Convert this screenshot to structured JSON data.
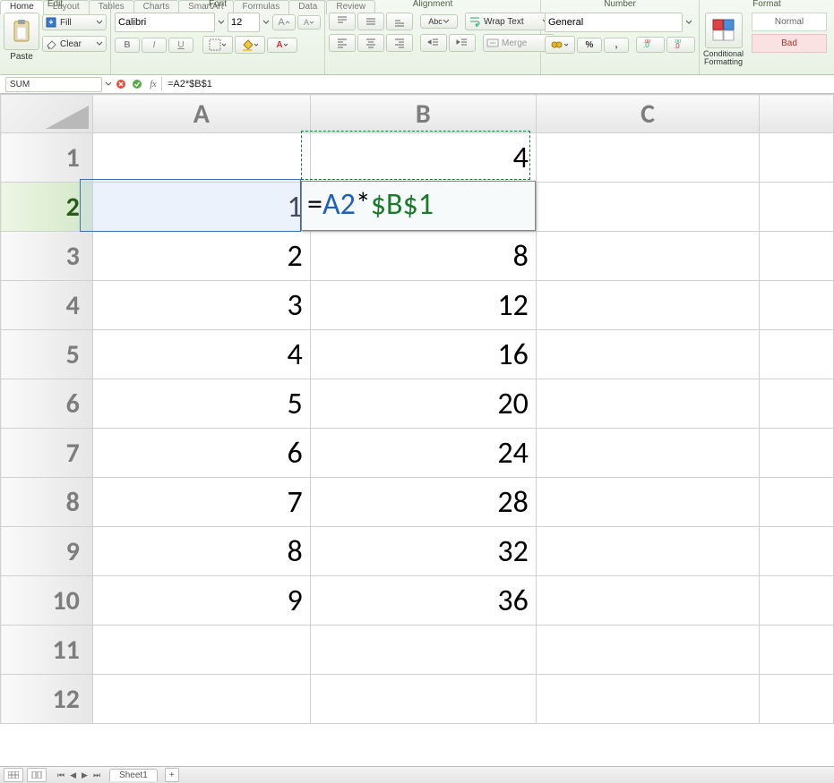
{
  "tabs": [
    "Home",
    "Layout",
    "Tables",
    "Charts",
    "SmartArt",
    "Formulas",
    "Data",
    "Review"
  ],
  "groups": {
    "edit_label": "Edit",
    "font_label": "Font",
    "align_label": "Alignment",
    "number_label": "Number",
    "format_label": "Format",
    "paste": "Paste",
    "fill": "Fill",
    "clear": "Clear",
    "font_name": "Calibri",
    "font_size": "12",
    "abc": "Abc",
    "wrap": "Wrap Text",
    "merge": "Merge",
    "numformat": "General",
    "percent": "%",
    "comma": ",",
    "cond": "Conditional",
    "cond2": "Formatting",
    "style1": "Normal",
    "style2": "Bad"
  },
  "formula_bar": {
    "name": "SUM",
    "formula": "=A2*$B$1"
  },
  "editing": {
    "prefix": "=",
    "ref1": "A2",
    "op": "*",
    "ref2": "$B$1"
  },
  "columns": [
    "A",
    "B",
    "C"
  ],
  "rows": [
    {
      "n": "1",
      "a": "",
      "b": "4"
    },
    {
      "n": "2",
      "a": "1",
      "b": "",
      "active": true
    },
    {
      "n": "3",
      "a": "2",
      "b": "8"
    },
    {
      "n": "4",
      "a": "3",
      "b": "12"
    },
    {
      "n": "5",
      "a": "4",
      "b": "16"
    },
    {
      "n": "6",
      "a": "5",
      "b": "20"
    },
    {
      "n": "7",
      "a": "6",
      "b": "24"
    },
    {
      "n": "8",
      "a": "7",
      "b": "28"
    },
    {
      "n": "9",
      "a": "8",
      "b": "32"
    },
    {
      "n": "10",
      "a": "9",
      "b": "36"
    },
    {
      "n": "11",
      "a": "",
      "b": ""
    },
    {
      "n": "12",
      "a": "",
      "b": ""
    }
  ],
  "status": {
    "sheet": "Sheet1",
    "plus": "+"
  },
  "chart_data": {
    "type": "table",
    "columns": [
      "A",
      "B"
    ],
    "rows": [
      [
        "",
        4
      ],
      [
        1,
        null
      ],
      [
        2,
        8
      ],
      [
        3,
        12
      ],
      [
        4,
        16
      ],
      [
        5,
        20
      ],
      [
        6,
        24
      ],
      [
        7,
        28
      ],
      [
        8,
        32
      ],
      [
        9,
        36
      ]
    ],
    "formula_B2": "=A2*$B$1"
  }
}
